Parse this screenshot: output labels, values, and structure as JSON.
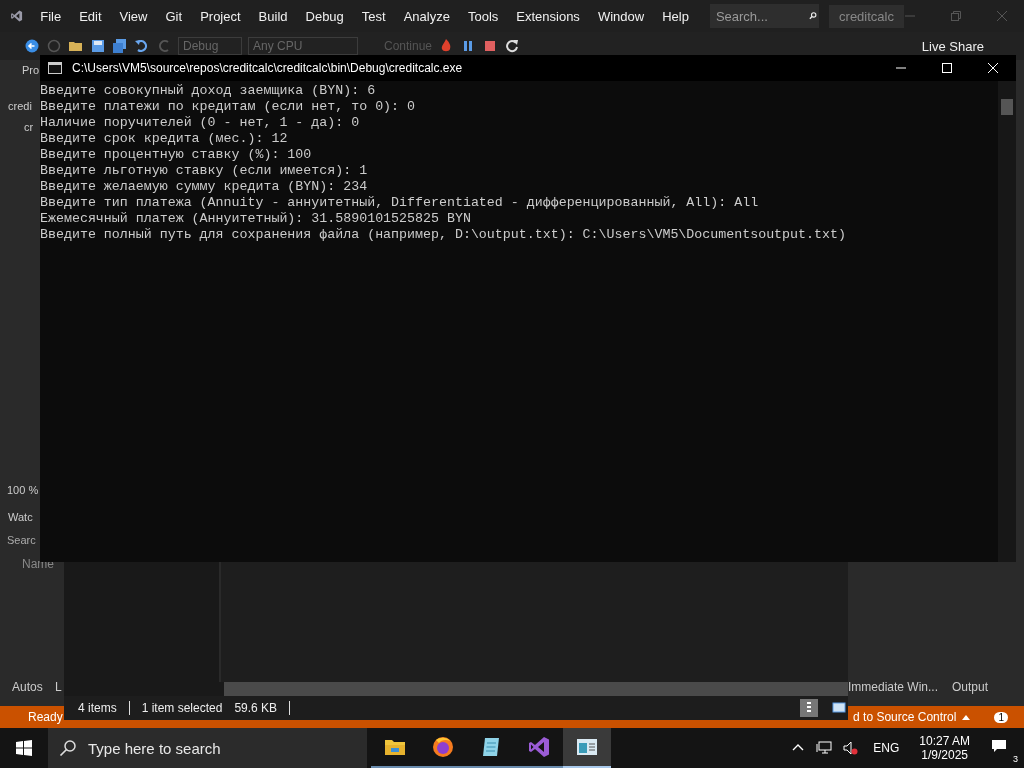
{
  "ide": {
    "menu": [
      "File",
      "Edit",
      "View",
      "Git",
      "Project",
      "Build",
      "Debug",
      "Test",
      "Analyze",
      "Tools",
      "Extensions",
      "Window",
      "Help"
    ],
    "search": {
      "placeholder": "Search..."
    },
    "solution_name": "creditcalc",
    "toolbar": {
      "configuration": "Debug",
      "platform": "Any CPU",
      "continue": "Continue",
      "live_share": "Live Share"
    },
    "left_panel": {
      "project_tab": "Pro",
      "solution_item": "credi",
      "file_item": "cr",
      "zoom": "100 %",
      "watch_title": "Watc",
      "watch_search": "Searc",
      "name_column": "Name",
      "tabs": [
        "Autos",
        "L"
      ]
    },
    "bottom_tabs": [
      "Immediate Win...",
      "Output"
    ],
    "status_bar": {
      "state": "Ready",
      "source_control": "d to Source Control",
      "notifications": "1"
    }
  },
  "explorer": {
    "item_count": "4 items",
    "selection": "1 item selected",
    "size": "59.6 KB"
  },
  "console": {
    "title": "C:\\Users\\VM5\\source\\repos\\creditcalc\\creditcalc\\bin\\Debug\\creditcalc.exe",
    "lines": [
      "Введите совокупный доход заемщика (BYN): 6",
      "Введите платежи по кредитам (если нет, то 0): 0",
      "Наличие поручителей (0 - нет, 1 - да): 0",
      "Введите срок кредита (мес.): 12",
      "Введите процентную ставку (%): 100",
      "Введите льготную ставку (если имеется): 1",
      "Введите желаемую сумму кредита (BYN): 234",
      "Введите тип платежа (Annuity - аннуитетный, Differentiated - дифференцированный, All): All",
      "Ежемесячный платеж (Аннуитетный): 31.5890101525825 BYN",
      "Введите полный путь для сохранения файла (например, D:\\output.txt): C:\\Users\\VM5\\Documentsoutput.txt)"
    ]
  },
  "taskbar": {
    "search": {
      "placeholder": "Type here to search"
    },
    "apps": [
      {
        "kind": "folder",
        "selected": false
      },
      {
        "kind": "browser",
        "selected": false
      },
      {
        "kind": "notepad",
        "selected": false
      },
      {
        "kind": "ide",
        "selected": false
      },
      {
        "kind": "console",
        "selected": true
      }
    ],
    "language": "ENG",
    "time": "10:27 AM",
    "date": "1/9/2025",
    "notifications": "3"
  }
}
